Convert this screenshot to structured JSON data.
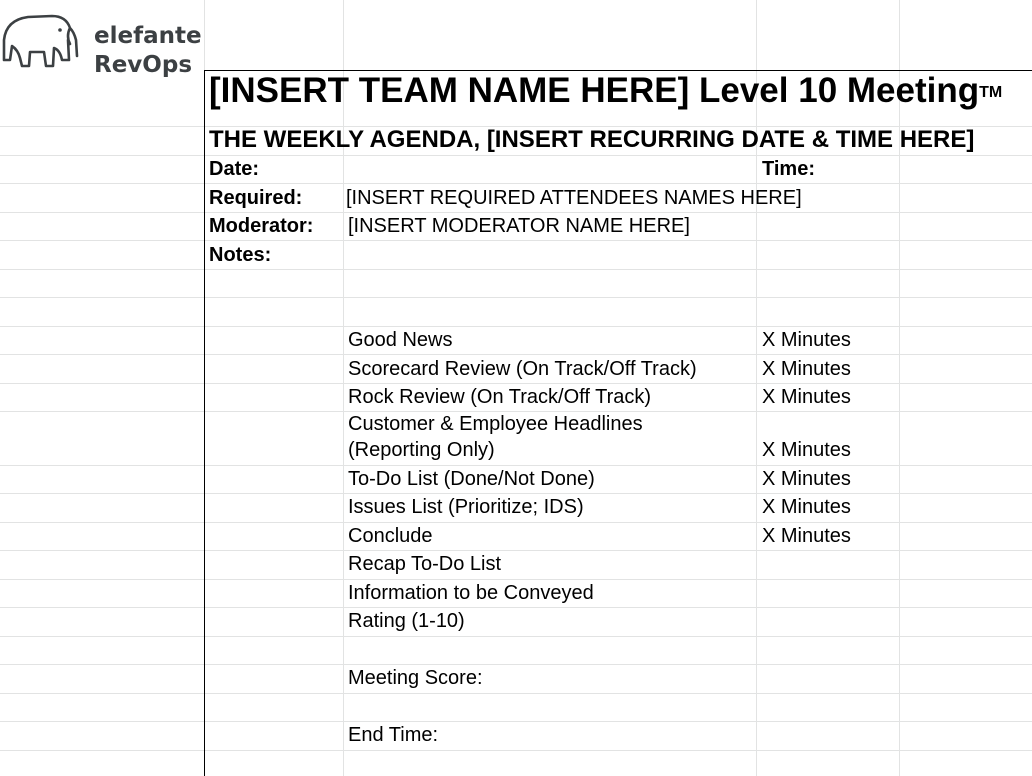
{
  "logo": {
    "line1": "elefante",
    "line2": "RevOps",
    "icon": "elephant-icon"
  },
  "title": "[INSERT TEAM NAME HERE] Level 10 Meeting",
  "title_mark": "TM",
  "subtitle": "THE WEEKLY AGENDA, [INSERT RECURRING DATE & TIME HERE]",
  "fields": {
    "date_label": "Date:",
    "time_label": "Time:",
    "required_label": "Required:",
    "required_value": "[INSERT REQUIRED ATTENDEES NAMES HERE]",
    "moderator_label": "Moderator:",
    "moderator_value": "[INSERT MODERATOR NAME HERE]",
    "notes_label": "Notes:"
  },
  "agenda": [
    {
      "item": "Good News",
      "duration": "X Minutes"
    },
    {
      "item": "Scorecard Review (On Track/Off Track)",
      "duration": "X Minutes"
    },
    {
      "item": "Rock Review (On Track/Off Track)",
      "duration": "X Minutes"
    },
    {
      "item": "Customer & Employee Headlines",
      "item2": "(Reporting Only)",
      "duration": "X Minutes"
    },
    {
      "item": "To-Do List (Done/Not Done)",
      "duration": "X Minutes"
    },
    {
      "item": "Issues List (Prioritize; IDS)",
      "duration": "X Minutes"
    },
    {
      "item": "Conclude",
      "duration": "X Minutes"
    },
    {
      "item": "Recap To-Do List"
    },
    {
      "item": "Information to be Conveyed"
    },
    {
      "item": "Rating (1-10)"
    }
  ],
  "meeting_score_label": "Meeting Score:",
  "end_time_label": "End Time:"
}
